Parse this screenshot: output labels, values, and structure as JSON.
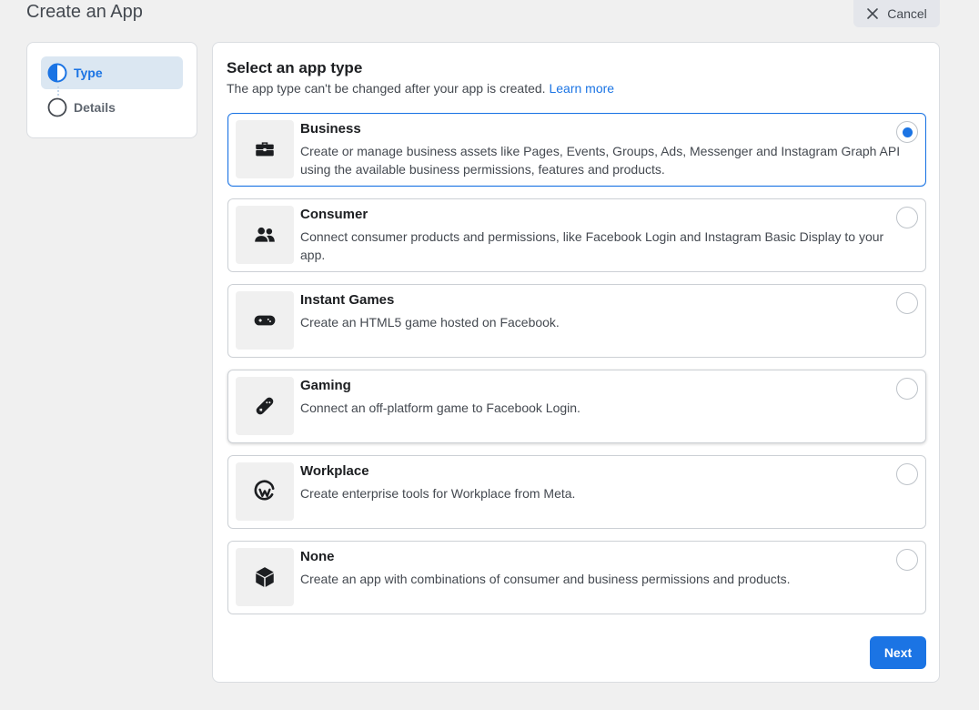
{
  "header": {
    "title": "Create an App",
    "cancel_label": "Cancel"
  },
  "stepper": {
    "steps": [
      {
        "label": "Type",
        "state": "current",
        "icon": "half-filled-circle-icon"
      },
      {
        "label": "Details",
        "state": "pending",
        "icon": "empty-circle-icon"
      }
    ]
  },
  "main": {
    "heading": "Select an app type",
    "subtitle": "The app type can't be changed after your app is created.",
    "learn_more": "Learn more",
    "selected_option": "Business",
    "options": [
      {
        "title": "Business",
        "description": "Create or manage business assets like Pages, Events, Groups, Ads, Messenger and Instagram Graph API using the available business permissions, features and products.",
        "icon": "briefcase-icon",
        "selected": true
      },
      {
        "title": "Consumer",
        "description": "Connect consumer products and permissions, like Facebook Login and Instagram Basic Display to your app.",
        "icon": "people-icon",
        "selected": false
      },
      {
        "title": "Instant Games",
        "description": "Create an HTML5 game hosted on Facebook.",
        "icon": "game-controller-icon",
        "selected": false
      },
      {
        "title": "Gaming",
        "description": "Connect an off-platform game to Facebook Login.",
        "icon": "gaming-controller-icon",
        "selected": false
      },
      {
        "title": "Workplace",
        "description": "Create enterprise tools for Workplace from Meta.",
        "icon": "workplace-logo-icon",
        "selected": false
      },
      {
        "title": "None",
        "description": "Create an app with combinations of consumer and business permissions and products.",
        "icon": "cube-icon",
        "selected": false
      }
    ],
    "next_label": "Next"
  },
  "colors": {
    "accent": "#1b74e4",
    "background": "#f0f0f0",
    "step_active_bg": "#dbe7f2"
  }
}
